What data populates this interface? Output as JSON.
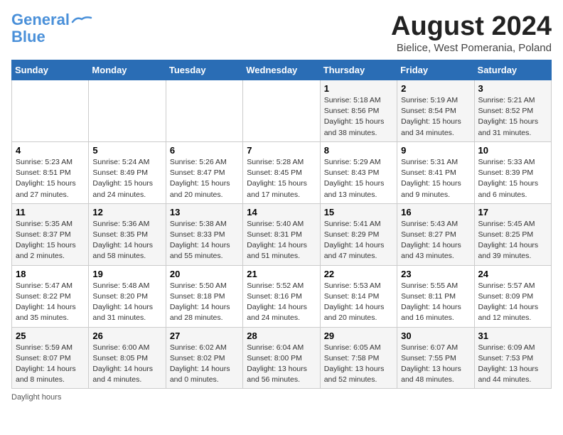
{
  "logo": {
    "line1": "General",
    "line2": "Blue"
  },
  "title": "August 2024",
  "subtitle": "Bielice, West Pomerania, Poland",
  "days_of_week": [
    "Sunday",
    "Monday",
    "Tuesday",
    "Wednesday",
    "Thursday",
    "Friday",
    "Saturday"
  ],
  "weeks": [
    [
      {
        "day": "",
        "info": ""
      },
      {
        "day": "",
        "info": ""
      },
      {
        "day": "",
        "info": ""
      },
      {
        "day": "",
        "info": ""
      },
      {
        "day": "1",
        "info": "Sunrise: 5:18 AM\nSunset: 8:56 PM\nDaylight: 15 hours and 38 minutes."
      },
      {
        "day": "2",
        "info": "Sunrise: 5:19 AM\nSunset: 8:54 PM\nDaylight: 15 hours and 34 minutes."
      },
      {
        "day": "3",
        "info": "Sunrise: 5:21 AM\nSunset: 8:52 PM\nDaylight: 15 hours and 31 minutes."
      }
    ],
    [
      {
        "day": "4",
        "info": "Sunrise: 5:23 AM\nSunset: 8:51 PM\nDaylight: 15 hours and 27 minutes."
      },
      {
        "day": "5",
        "info": "Sunrise: 5:24 AM\nSunset: 8:49 PM\nDaylight: 15 hours and 24 minutes."
      },
      {
        "day": "6",
        "info": "Sunrise: 5:26 AM\nSunset: 8:47 PM\nDaylight: 15 hours and 20 minutes."
      },
      {
        "day": "7",
        "info": "Sunrise: 5:28 AM\nSunset: 8:45 PM\nDaylight: 15 hours and 17 minutes."
      },
      {
        "day": "8",
        "info": "Sunrise: 5:29 AM\nSunset: 8:43 PM\nDaylight: 15 hours and 13 minutes."
      },
      {
        "day": "9",
        "info": "Sunrise: 5:31 AM\nSunset: 8:41 PM\nDaylight: 15 hours and 9 minutes."
      },
      {
        "day": "10",
        "info": "Sunrise: 5:33 AM\nSunset: 8:39 PM\nDaylight: 15 hours and 6 minutes."
      }
    ],
    [
      {
        "day": "11",
        "info": "Sunrise: 5:35 AM\nSunset: 8:37 PM\nDaylight: 15 hours and 2 minutes."
      },
      {
        "day": "12",
        "info": "Sunrise: 5:36 AM\nSunset: 8:35 PM\nDaylight: 14 hours and 58 minutes."
      },
      {
        "day": "13",
        "info": "Sunrise: 5:38 AM\nSunset: 8:33 PM\nDaylight: 14 hours and 55 minutes."
      },
      {
        "day": "14",
        "info": "Sunrise: 5:40 AM\nSunset: 8:31 PM\nDaylight: 14 hours and 51 minutes."
      },
      {
        "day": "15",
        "info": "Sunrise: 5:41 AM\nSunset: 8:29 PM\nDaylight: 14 hours and 47 minutes."
      },
      {
        "day": "16",
        "info": "Sunrise: 5:43 AM\nSunset: 8:27 PM\nDaylight: 14 hours and 43 minutes."
      },
      {
        "day": "17",
        "info": "Sunrise: 5:45 AM\nSunset: 8:25 PM\nDaylight: 14 hours and 39 minutes."
      }
    ],
    [
      {
        "day": "18",
        "info": "Sunrise: 5:47 AM\nSunset: 8:22 PM\nDaylight: 14 hours and 35 minutes."
      },
      {
        "day": "19",
        "info": "Sunrise: 5:48 AM\nSunset: 8:20 PM\nDaylight: 14 hours and 31 minutes."
      },
      {
        "day": "20",
        "info": "Sunrise: 5:50 AM\nSunset: 8:18 PM\nDaylight: 14 hours and 28 minutes."
      },
      {
        "day": "21",
        "info": "Sunrise: 5:52 AM\nSunset: 8:16 PM\nDaylight: 14 hours and 24 minutes."
      },
      {
        "day": "22",
        "info": "Sunrise: 5:53 AM\nSunset: 8:14 PM\nDaylight: 14 hours and 20 minutes."
      },
      {
        "day": "23",
        "info": "Sunrise: 5:55 AM\nSunset: 8:11 PM\nDaylight: 14 hours and 16 minutes."
      },
      {
        "day": "24",
        "info": "Sunrise: 5:57 AM\nSunset: 8:09 PM\nDaylight: 14 hours and 12 minutes."
      }
    ],
    [
      {
        "day": "25",
        "info": "Sunrise: 5:59 AM\nSunset: 8:07 PM\nDaylight: 14 hours and 8 minutes."
      },
      {
        "day": "26",
        "info": "Sunrise: 6:00 AM\nSunset: 8:05 PM\nDaylight: 14 hours and 4 minutes."
      },
      {
        "day": "27",
        "info": "Sunrise: 6:02 AM\nSunset: 8:02 PM\nDaylight: 14 hours and 0 minutes."
      },
      {
        "day": "28",
        "info": "Sunrise: 6:04 AM\nSunset: 8:00 PM\nDaylight: 13 hours and 56 minutes."
      },
      {
        "day": "29",
        "info": "Sunrise: 6:05 AM\nSunset: 7:58 PM\nDaylight: 13 hours and 52 minutes."
      },
      {
        "day": "30",
        "info": "Sunrise: 6:07 AM\nSunset: 7:55 PM\nDaylight: 13 hours and 48 minutes."
      },
      {
        "day": "31",
        "info": "Sunrise: 6:09 AM\nSunset: 7:53 PM\nDaylight: 13 hours and 44 minutes."
      }
    ]
  ],
  "footer": "Daylight hours"
}
